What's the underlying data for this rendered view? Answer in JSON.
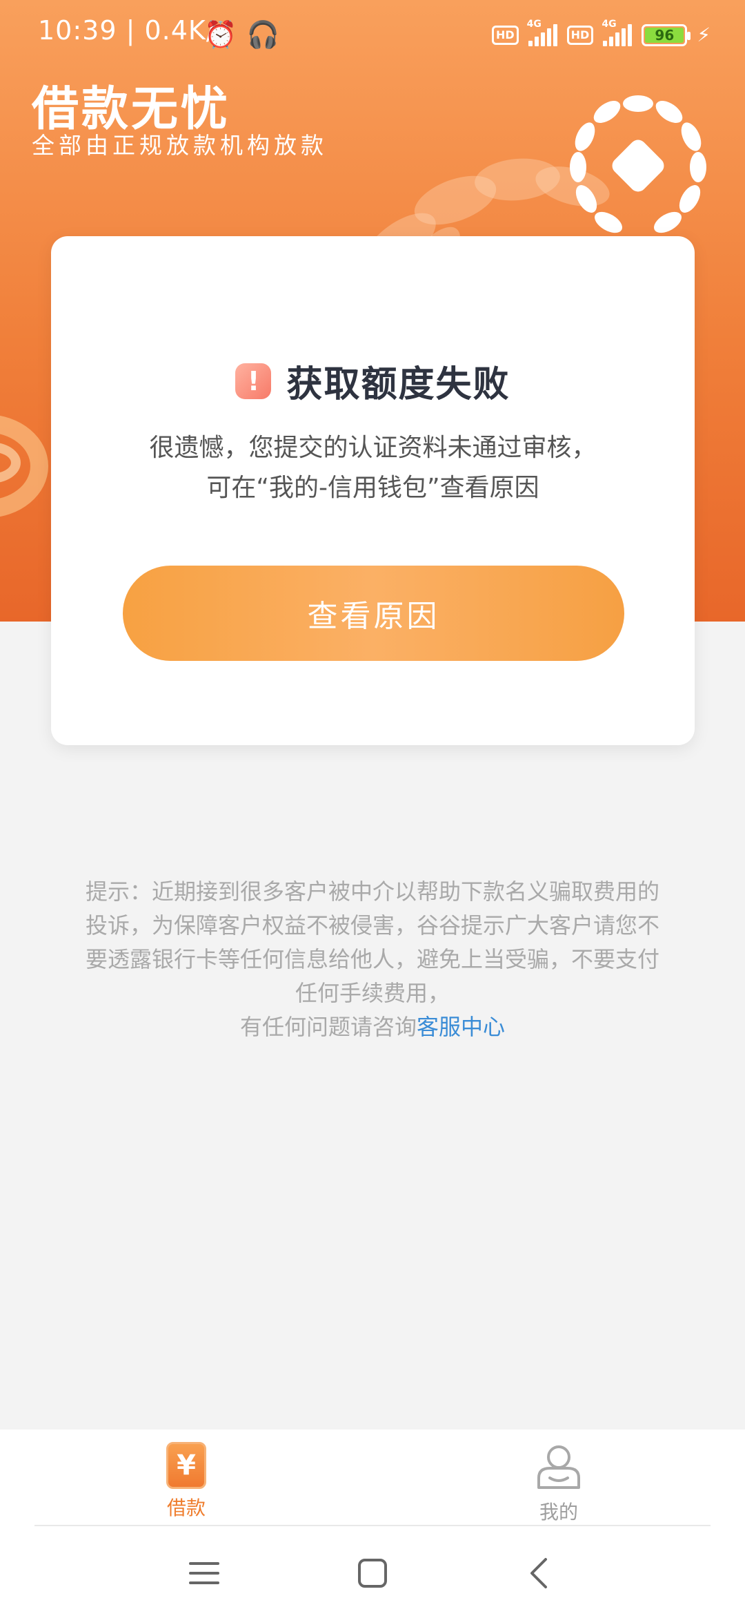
{
  "status_bar": {
    "time_speed": "10:39 | 0.4K/s",
    "sim1_hd": "HD",
    "sim1_net": "4G",
    "sim2_hd": "HD",
    "sim2_net": "4G",
    "battery": "96"
  },
  "header": {
    "title": "借款无忧",
    "subtitle": "全部由正规放款机构放款"
  },
  "card": {
    "title": "获取额度失败",
    "message_line1": "很遗憾，您提交的认证资料未通过审核，",
    "message_line2": "可在“我的-信用钱包”查看原因",
    "button_label": "查看原因"
  },
  "tip": {
    "line1": "提示：近期接到很多客户被中介以帮助下款名义骗取费用的",
    "line2": "投诉，为保障客户权益不被侵害，谷谷提示广大客户请您不",
    "line3": "要透露银行卡等任何信息给他人，避免上当受骗，不要支付",
    "line4": "任何手续费用，",
    "line5_prefix": "有任何问题请咨询",
    "link": "客服中心"
  },
  "tabbar": {
    "loan_label": "借款",
    "loan_icon_char": "¥",
    "mine_label": "我的"
  },
  "colors": {
    "brand_orange": "#f07f3a",
    "button_orange": "#fbb065",
    "link_blue": "#3a8cd6",
    "warning_red": "#f77a68"
  }
}
